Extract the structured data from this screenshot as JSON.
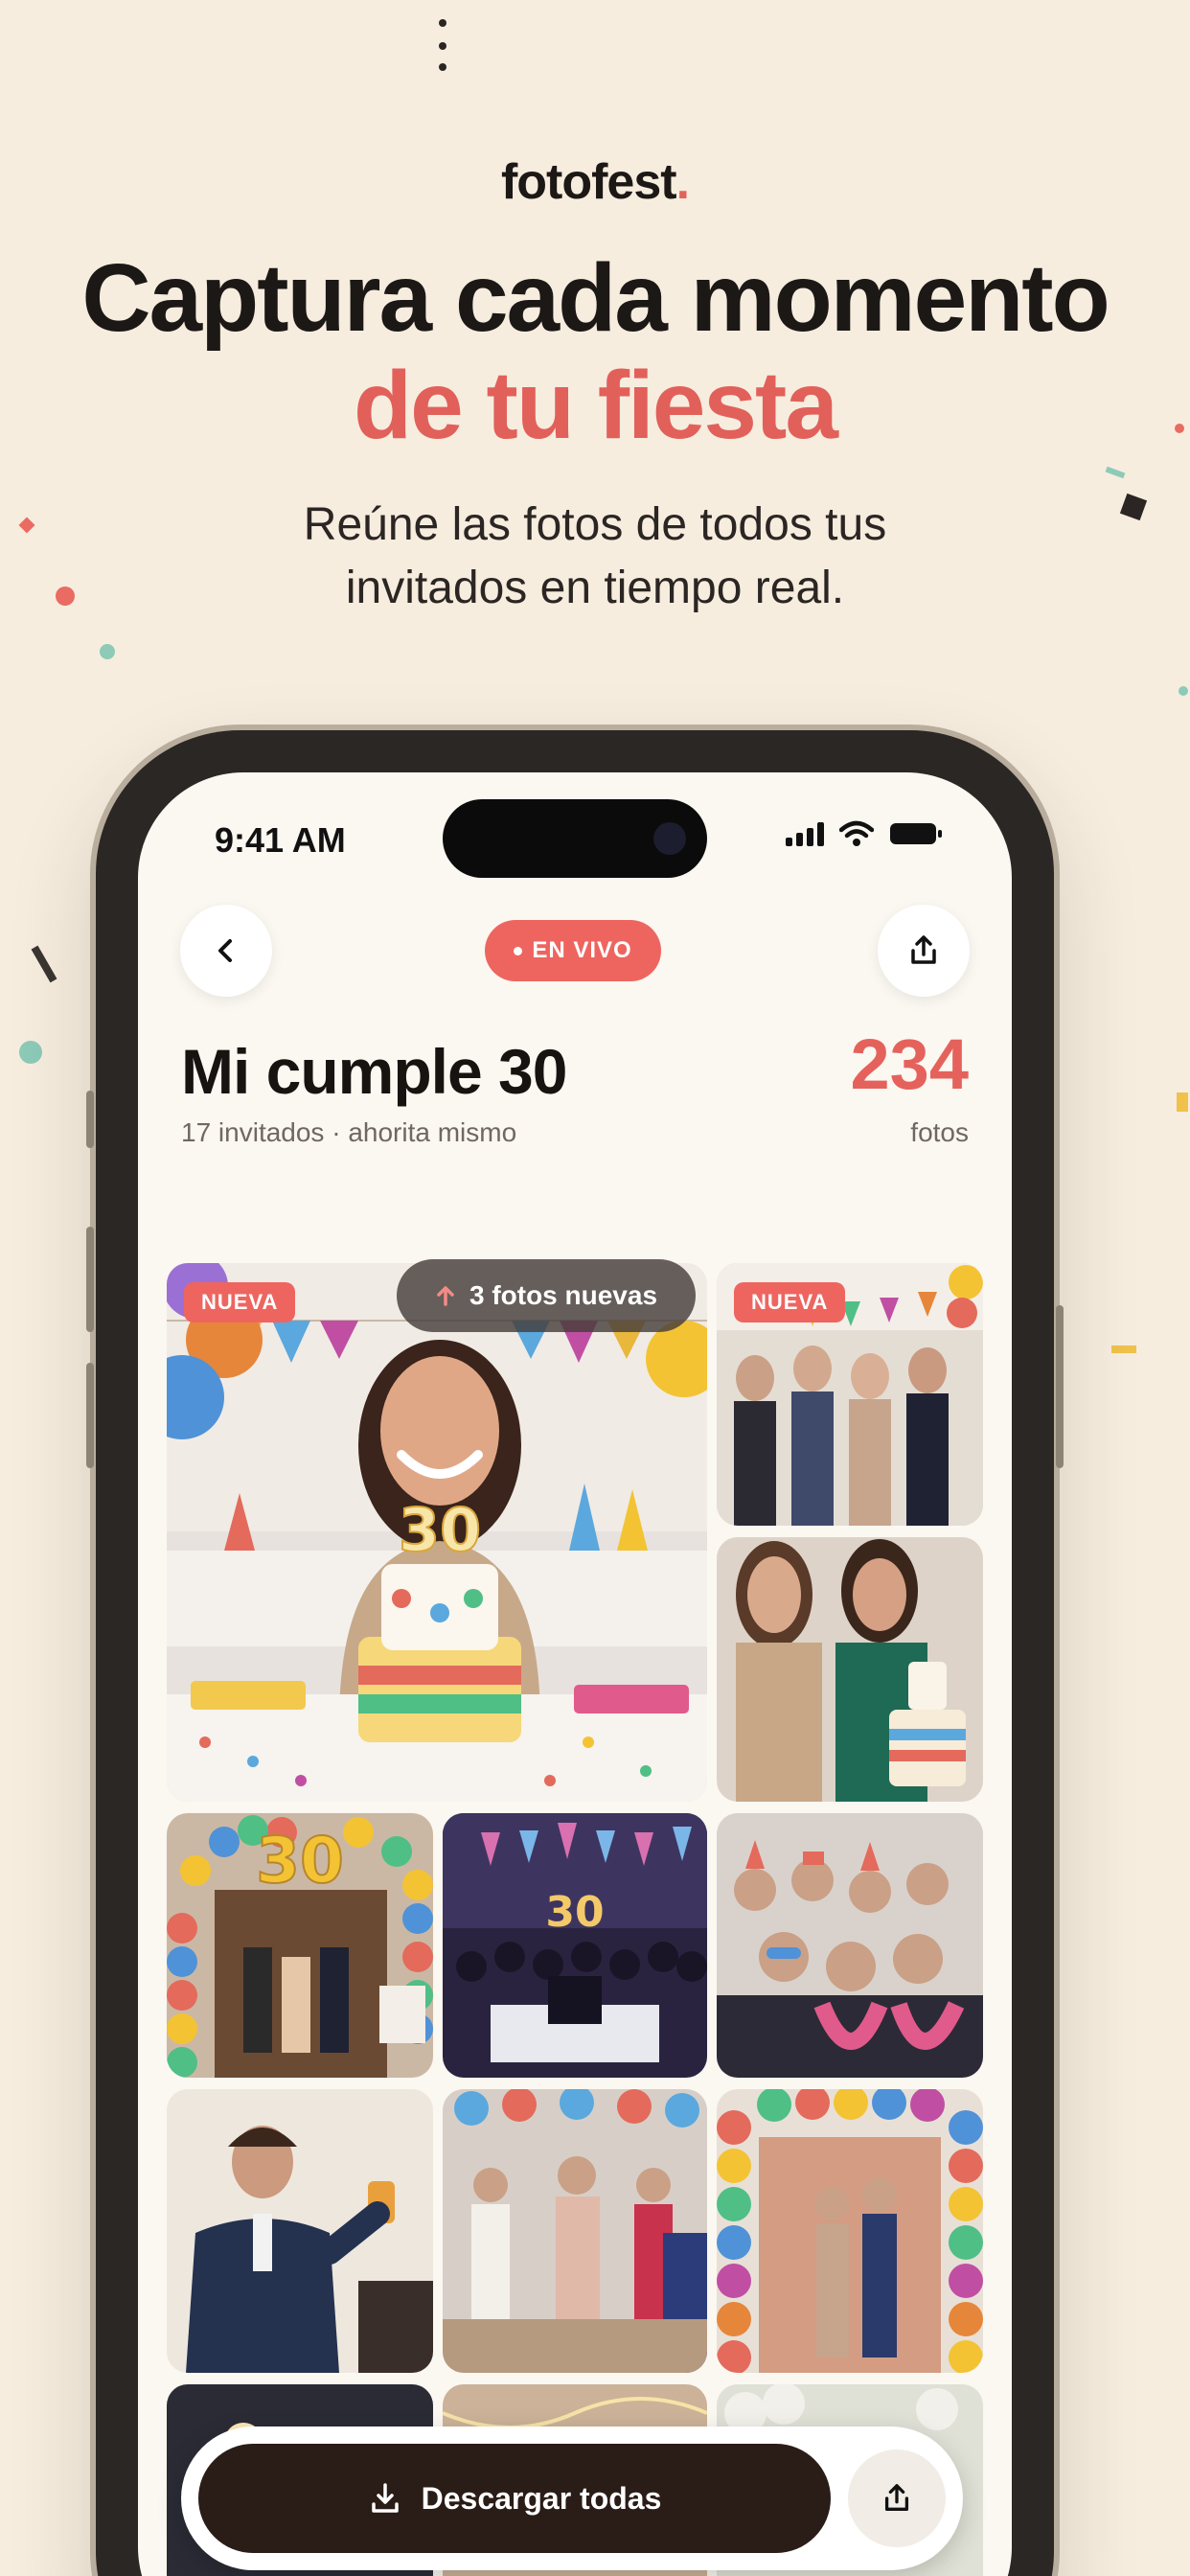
{
  "brand": {
    "name": "fotofest",
    "dot": "."
  },
  "headline": {
    "line1": "Captura cada momento",
    "line2": "de tu fiesta"
  },
  "subline": {
    "line1": "Reúne las fotos de todos tus",
    "line2": "invitados en tiempo real."
  },
  "status_bar": {
    "time": "9:41 AM"
  },
  "event": {
    "live_label": "EN VIVO",
    "title": "Mi cumple 30",
    "meta": "17 invitados · ahorita mismo",
    "photo_count": "234",
    "photo_count_label": "fotos"
  },
  "grid": {
    "new_photos_label": "3 fotos nuevas",
    "new_badge": "NUEVA",
    "cake_number": "30",
    "arch_number": "30",
    "sign_text": "30"
  },
  "actions": {
    "download_all": "Descargar todas"
  },
  "colors": {
    "background": "#f6eddf",
    "accent": "#e5625c",
    "dark_button": "#2a1c17"
  }
}
